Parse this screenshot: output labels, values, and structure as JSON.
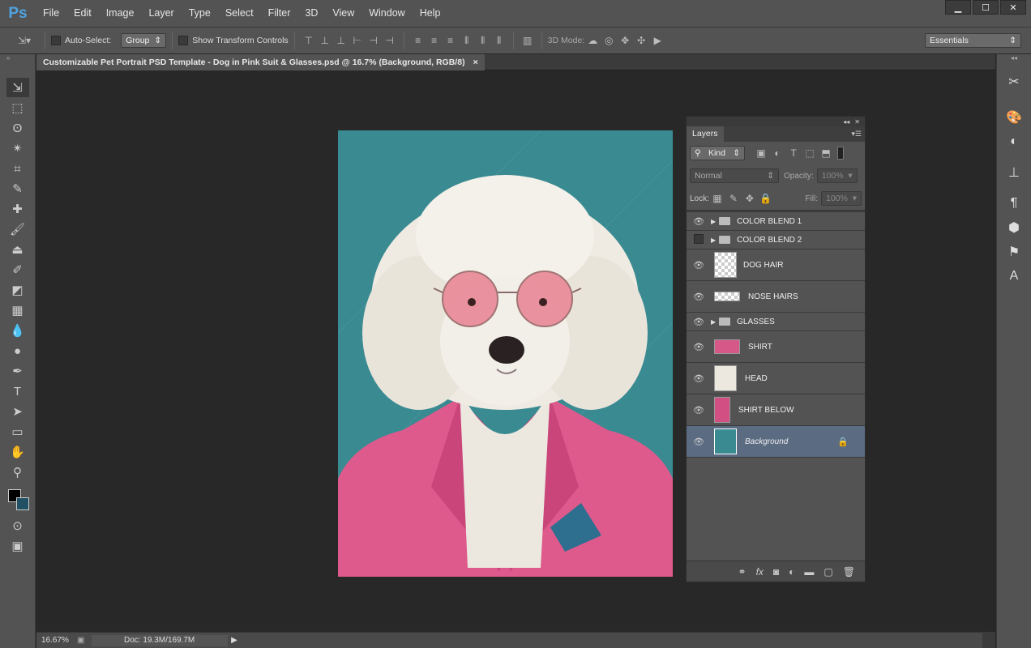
{
  "app": {
    "logo": "Ps"
  },
  "menu": [
    "File",
    "Edit",
    "Image",
    "Layer",
    "Type",
    "Select",
    "Filter",
    "3D",
    "View",
    "Window",
    "Help"
  ],
  "window_controls": {
    "minimize": "▁",
    "maximize": "☐",
    "close": "✕"
  },
  "options": {
    "auto_select_label": "Auto-Select:",
    "auto_select_value": "Group",
    "transform_label": "Show Transform Controls",
    "mode3d_label": "3D Mode:",
    "workspace": "Essentials"
  },
  "document": {
    "tab_title": "Customizable Pet Portrait PSD Template - Dog in Pink Suit & Glasses.psd @ 16.7% (Background, RGB/8)",
    "tab_close": "×"
  },
  "status": {
    "zoom": "16.67%",
    "doc": "Doc: 19.3M/169.7M"
  },
  "layers_panel": {
    "tab": "Layers",
    "filter_kind": "Kind",
    "blend_mode": "Normal",
    "opacity_label": "Opacity:",
    "opacity_value": "100%",
    "lock_label": "Lock:",
    "fill_label": "Fill:",
    "fill_value": "100%",
    "layers": [
      {
        "name": "COLOR BLEND 1",
        "type": "group",
        "visible": true
      },
      {
        "name": "COLOR BLEND 2",
        "type": "group",
        "visible": false
      },
      {
        "name": "DOG HAIR",
        "type": "layer",
        "visible": true
      },
      {
        "name": "NOSE HAIRS",
        "type": "layer",
        "visible": true
      },
      {
        "name": "GLASSES",
        "type": "group",
        "visible": true
      },
      {
        "name": "SHIRT",
        "type": "layer",
        "visible": true
      },
      {
        "name": "HEAD",
        "type": "layer",
        "visible": true
      },
      {
        "name": "SHIRT BELOW",
        "type": "layer",
        "visible": true
      },
      {
        "name": "Background",
        "type": "background",
        "visible": true,
        "selected": true
      }
    ]
  },
  "colors": {
    "ui_dark": "#535353",
    "canvas_bg": "#282828",
    "selected_layer": "#5a6b82",
    "image_bg": "#3a8a92",
    "suit_pink": "#e0558a"
  }
}
